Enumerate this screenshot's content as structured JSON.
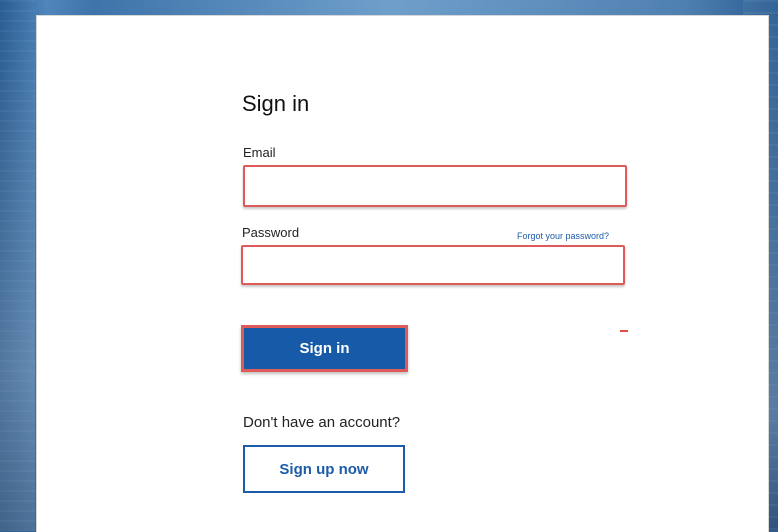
{
  "signin": {
    "title": "Sign in",
    "email_label": "Email",
    "email_value": "",
    "password_label": "Password",
    "password_value": "",
    "forgot_password_link": "Forgot your password?",
    "submit_label": "Sign in",
    "account_prompt": "Don't have an account?",
    "signup_label": "Sign up now"
  }
}
